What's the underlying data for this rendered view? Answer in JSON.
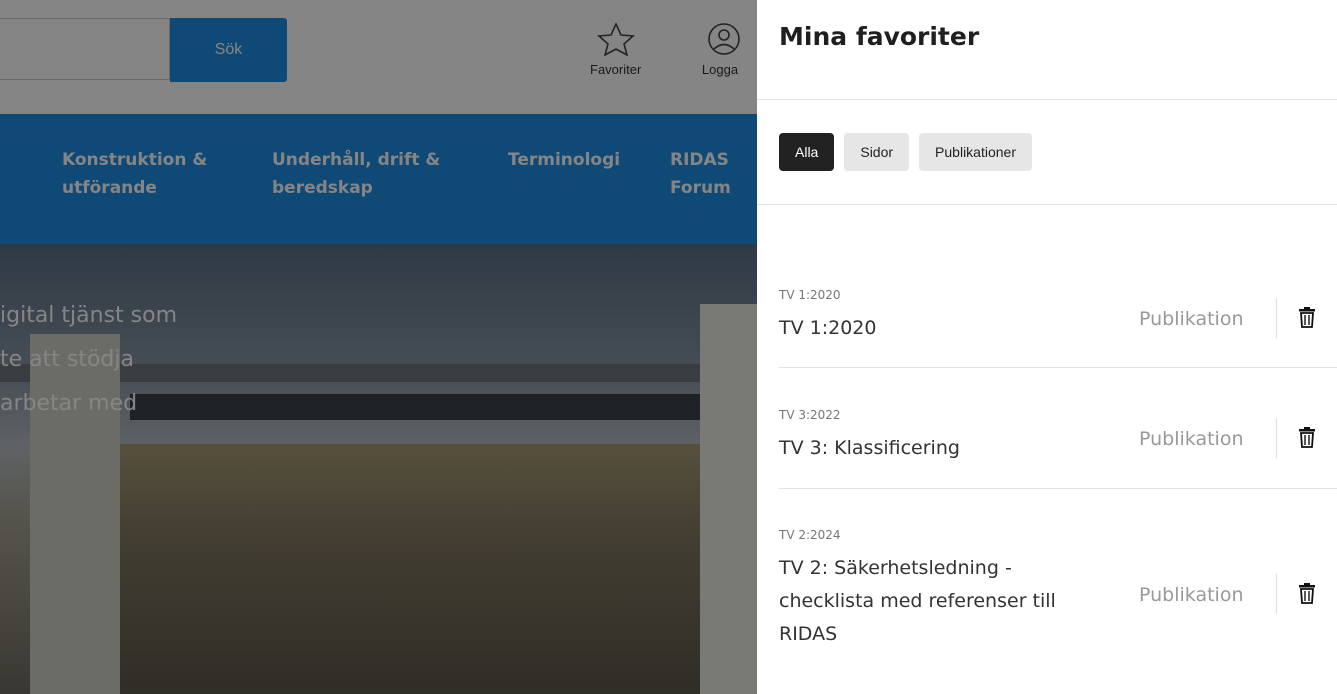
{
  "site": {
    "search_button": "Sök",
    "favorites_label": "Favoriter",
    "login_label": "Logga",
    "nav": [
      {
        "line1": "Konstruktion &",
        "line2": "utförande"
      },
      {
        "line1": "Underhåll, drift &",
        "line2": "beredskap"
      },
      {
        "line1": "Terminologi",
        "line2": ""
      },
      {
        "line1": "RIDAS",
        "line2": "Forum"
      }
    ],
    "hero_lines": [
      "igital tjänst som",
      "te att stödja",
      " arbetar med"
    ]
  },
  "panel": {
    "title": "Mina favoriter",
    "filters": [
      "Alla",
      "Sidor",
      "Publikationer"
    ],
    "active_filter": "Alla",
    "items": [
      {
        "code": "TV 1:2020",
        "title": "TV 1:2020",
        "type": "Publikation"
      },
      {
        "code": "TV 3:2022",
        "title": "TV 3: Klassificering",
        "type": "Publikation"
      },
      {
        "code": "TV 2:2024",
        "title": "TV 2: Säkerhetsledning - checklista med referenser till RIDAS",
        "type": "Publikation"
      }
    ]
  },
  "colors": {
    "brand_blue": "#1d8ce0",
    "active_chip": "#222222"
  }
}
